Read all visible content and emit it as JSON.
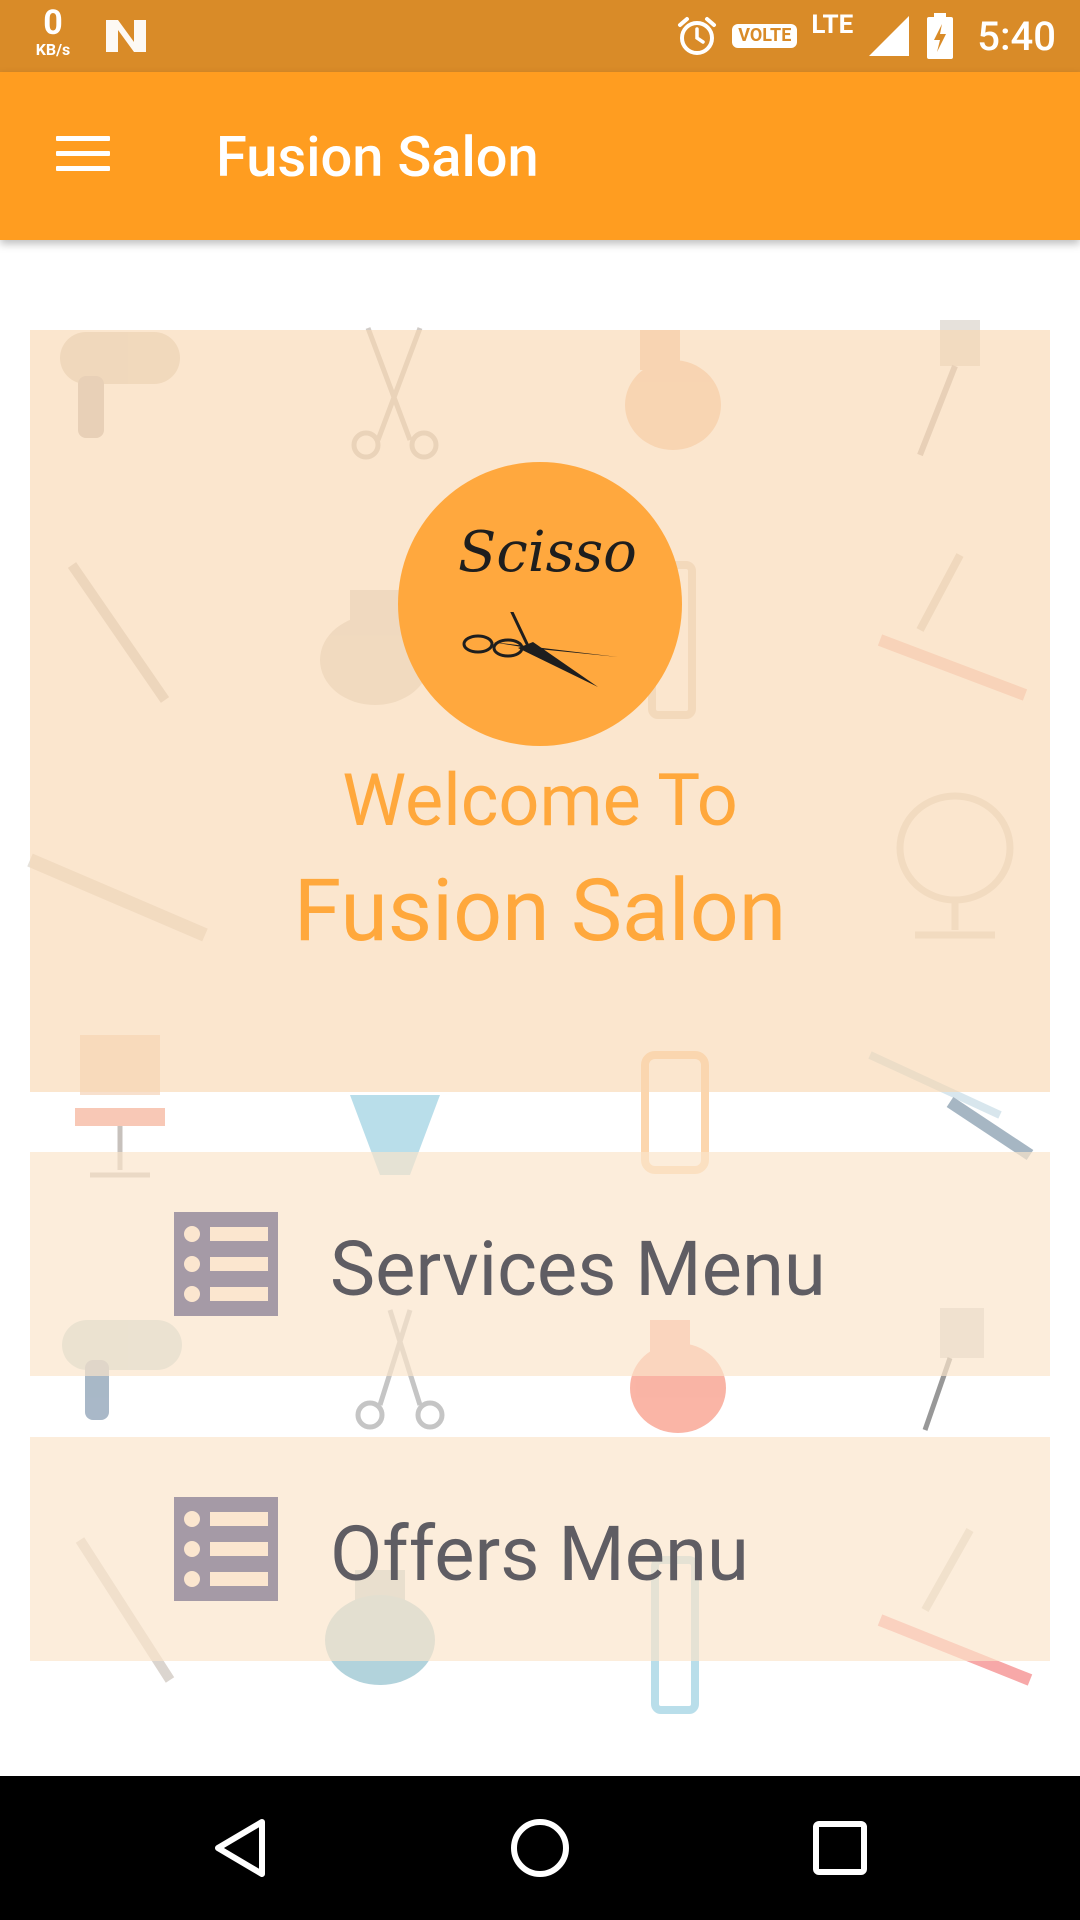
{
  "status_bar": {
    "net_speed_value": "0",
    "net_speed_unit": "KB/s",
    "volte": "VOLTE",
    "network": "LTE",
    "time": "5:40",
    "icons": [
      "n-notification-icon",
      "alarm-icon",
      "volte-icon",
      "signal-icon",
      "battery-charging-icon"
    ]
  },
  "app_bar": {
    "title": "Fusion Salon",
    "menu_icon": "hamburger-menu-icon",
    "color": "#ff9d20"
  },
  "hero": {
    "logo_text": "Scisso",
    "welcome": "Welcome To",
    "salon_name": "Fusion Salon",
    "accent_color": "#ffa83c"
  },
  "menu": {
    "items": [
      {
        "label": "Services Menu",
        "icon": "list-icon"
      },
      {
        "label": "Offers Menu",
        "icon": "list-icon"
      }
    ]
  },
  "nav_bar": {
    "buttons": [
      "back-icon",
      "home-icon",
      "recents-icon"
    ]
  }
}
